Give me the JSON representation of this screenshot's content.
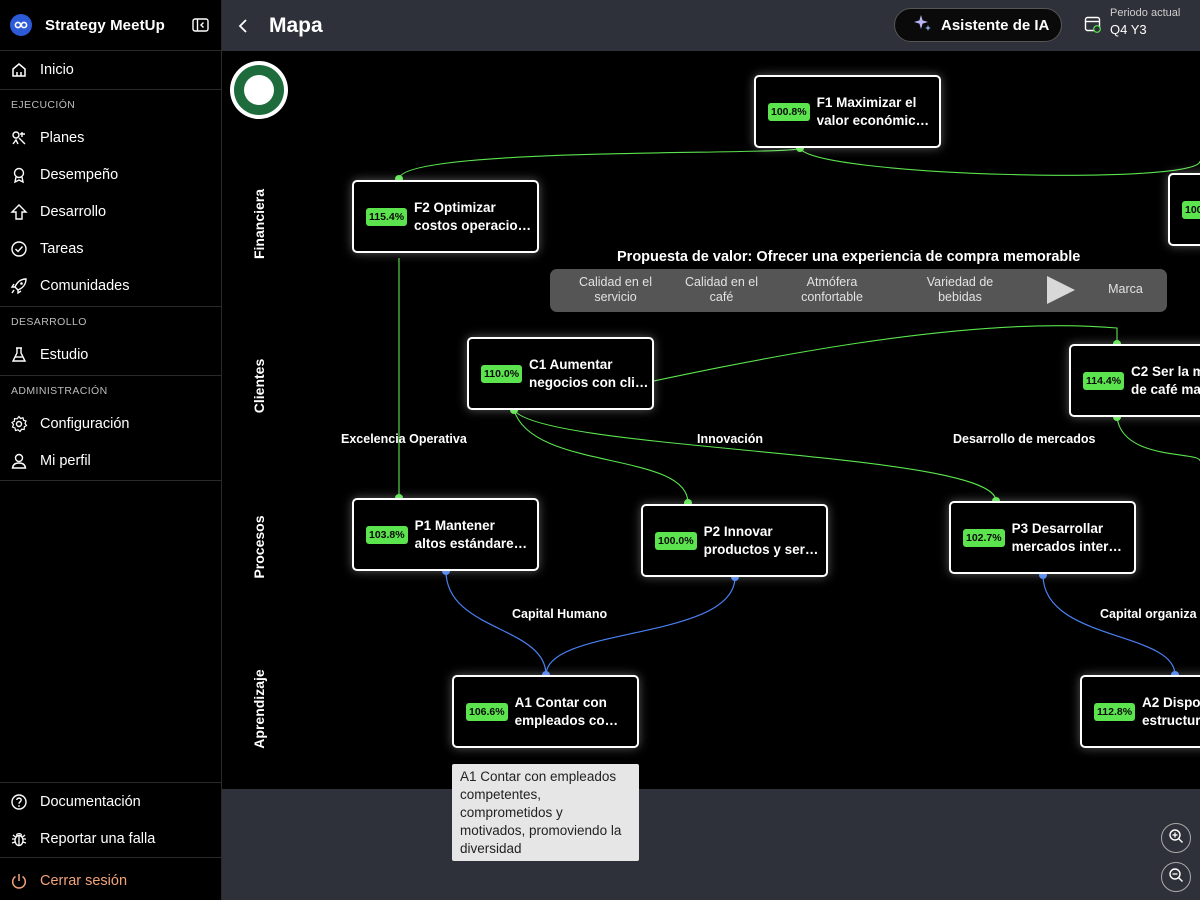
{
  "sidebar": {
    "app_name": "Strategy MeetUp",
    "items": {
      "inicio": "Inicio",
      "planes": "Planes",
      "desempeno": "Desempeño",
      "desarrollo": "Desarrollo",
      "tareas": "Tareas",
      "comunidades": "Comunidades",
      "estudio": "Estudio",
      "configuracion": "Configuración",
      "mi_perfil": "Mi perfil",
      "documentacion": "Documentación",
      "reportar": "Reportar una falla",
      "cerrar": "Cerrar sesión"
    },
    "sections": {
      "ejecucion": "EJECUCIÓN",
      "desarrollo": "DESARROLLO",
      "administracion": "ADMINISTRACIÓN"
    }
  },
  "header": {
    "title": "Mapa",
    "ai_button": "Asistente de IA",
    "period_label": "Periodo actual",
    "period_value": "Q4 Y3"
  },
  "map": {
    "lanes": {
      "financiera": "Financiera",
      "clientes": "Clientes",
      "procesos": "Procesos",
      "aprendizaje": "Aprendizaje"
    },
    "themes": {
      "excelencia": "Excelencia Operativa",
      "innovacion": "Innovación",
      "desarrollo_mercados": "Desarrollo de mercados",
      "capital_humano": "Capital Humano",
      "capital_org": "Capital organiza"
    },
    "value_proposition": {
      "title": "Propuesta de valor: Ofrecer una experiencia de compra memorable",
      "items": [
        "Calidad en el servicio",
        "Calidad en el café",
        "Atmófera confortable",
        "Variedad de bebidas",
        "Marca"
      ]
    },
    "nodes": {
      "f1": {
        "pct": "100.8%",
        "line1": "F1 Maximizar el",
        "line2": "valor económic…"
      },
      "f2": {
        "pct": "115.4%",
        "line1": "F2 Optimizar",
        "line2": "costos operacio…"
      },
      "f3": {
        "pct": "100"
      },
      "c1": {
        "pct": "110.0%",
        "line1": "C1 Aumentar",
        "line2": "negocios con cli…"
      },
      "c2": {
        "pct": "114.4%",
        "line1": "C2 Ser la m",
        "line2": "de café ma"
      },
      "p1": {
        "pct": "103.8%",
        "line1": "P1 Mantener",
        "line2": "altos estándare…"
      },
      "p2": {
        "pct": "100.0%",
        "line1": "P2 Innovar",
        "line2": "productos y ser…"
      },
      "p3": {
        "pct": "102.7%",
        "line1": "P3 Desarrollar",
        "line2": "mercados inter…"
      },
      "a1": {
        "pct": "106.6%",
        "line1": "A1 Contar con",
        "line2": "empleados co…"
      },
      "a2": {
        "pct": "112.8%",
        "line1": "A2 Dispon",
        "line2": "estructur"
      }
    },
    "tooltip": "A1 Contar con empleados competentes, comprometidos y motivados, promoviendo la diversidad"
  }
}
